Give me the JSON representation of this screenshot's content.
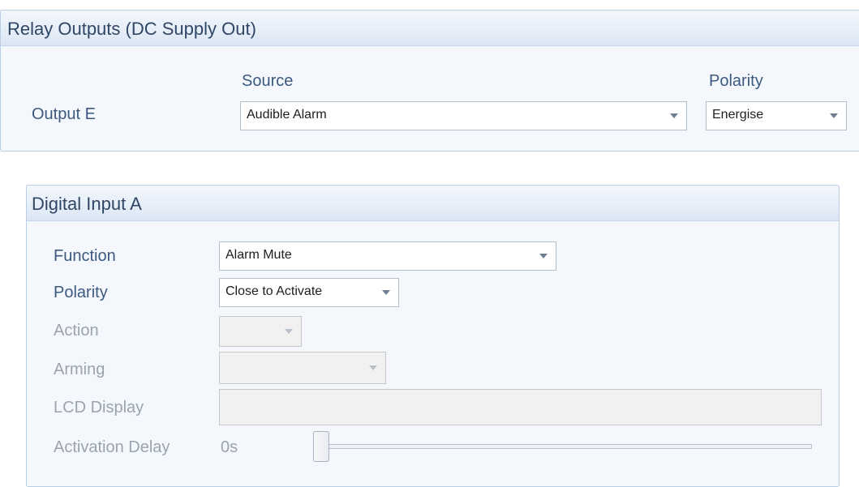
{
  "relay_panel": {
    "title": "Relay Outputs (DC Supply Out)",
    "source_header": "Source",
    "polarity_header": "Polarity",
    "output_label": "Output E",
    "source_value": "Audible Alarm",
    "polarity_value": "Energise"
  },
  "digital_input_panel": {
    "title": "Digital Input A",
    "function_label": "Function",
    "function_value": "Alarm Mute",
    "polarity_label": "Polarity",
    "polarity_value": "Close to Activate",
    "action_label": "Action",
    "action_value": "",
    "arming_label": "Arming",
    "arming_value": "",
    "lcd_display_label": "LCD Display",
    "lcd_display_value": "",
    "activation_delay_label": "Activation Delay",
    "activation_delay_value": "0s",
    "activation_delay_fraction": 0
  },
  "icons": {
    "dropdown": "chevron-down-icon"
  },
  "colors": {
    "label_text": "#3c5a80",
    "disabled_label_text": "#9aa4b0",
    "panel_background": "#f4f8fc",
    "panel_border": "#b9cde3"
  }
}
